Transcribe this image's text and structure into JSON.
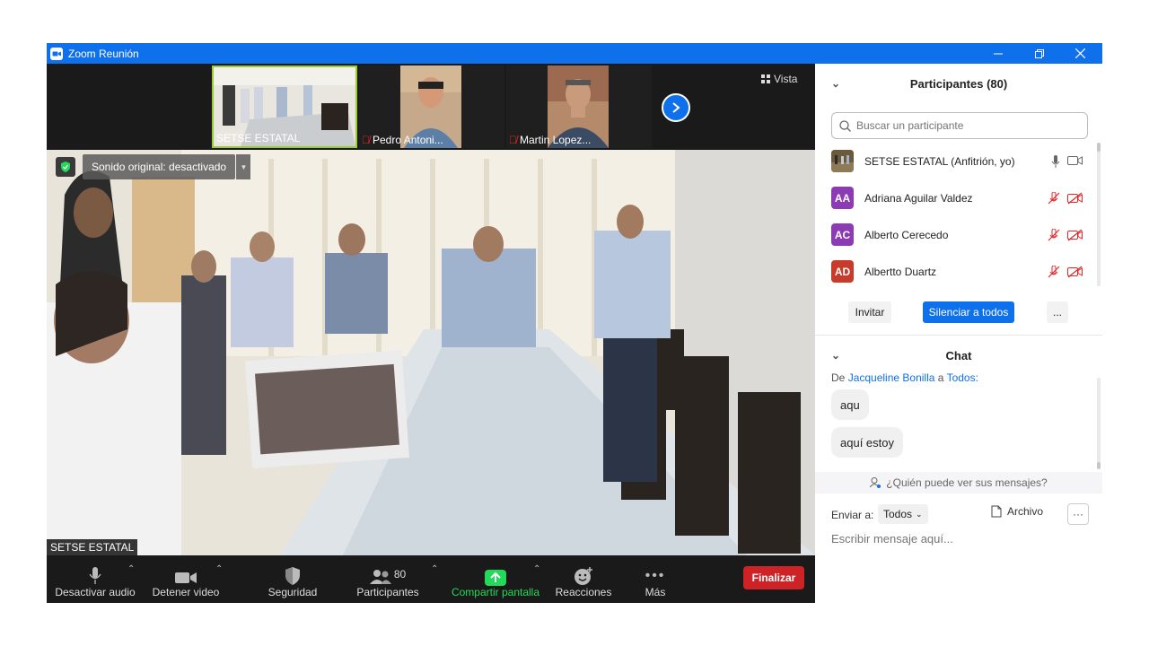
{
  "window": {
    "title": "Zoom Reunión"
  },
  "top_strip": {
    "thumbnails": [
      {
        "name": "SETSE ESTATAL",
        "muted": false
      },
      {
        "name": "Pedro Antoni...",
        "muted": true
      },
      {
        "name": "Martin Lopez...",
        "muted": true
      }
    ],
    "view_label": "Vista"
  },
  "main_video": {
    "sound_label": "Sonido original: desactivado",
    "speaker_name": "SETSE ESTATAL"
  },
  "toolbar": {
    "mute": "Desactivar audio",
    "video": "Detener video",
    "security": "Seguridad",
    "participants": "Participantes",
    "participants_count": "80",
    "share": "Compartir pantalla",
    "reactions": "Reacciones",
    "more": "Más",
    "end": "Finalizar"
  },
  "participants_panel": {
    "title": "Participantes (80)",
    "search_placeholder": "Buscar un participante",
    "participants": [
      {
        "name": "SETSE ESTATAL (Anfitrión, yo)",
        "initials": "",
        "color": "#6b5a3a"
      },
      {
        "name": "Adriana Aguilar Valdez",
        "initials": "AA",
        "color": "#8c3bb5"
      },
      {
        "name": "Alberto Cerecedo",
        "initials": "AC",
        "color": "#8c3bb5"
      },
      {
        "name": "Albertto Duartz",
        "initials": "AD",
        "color": "#c83a2a"
      }
    ],
    "invite": "Invitar",
    "mute_all": "Silenciar a todos",
    "more": "..."
  },
  "chat": {
    "title": "Chat",
    "from_prefix": "De",
    "from_name": "Jacqueline Bonilla",
    "from_mid": "a",
    "from_to": "Todos:",
    "messages": [
      "aqu",
      "aquí estoy"
    ],
    "who_can_see": "¿Quién puede ver sus mensajes?",
    "send_to_label": "Enviar a:",
    "send_to_value": "Todos",
    "file_label": "Archivo",
    "more": "···",
    "compose_placeholder": "Escribir mensaje aquí..."
  },
  "colors": {
    "zoom_blue": "#0e71eb",
    "end_red": "#cd2327",
    "share_green": "#23d959",
    "muted_red": "#e02828"
  }
}
